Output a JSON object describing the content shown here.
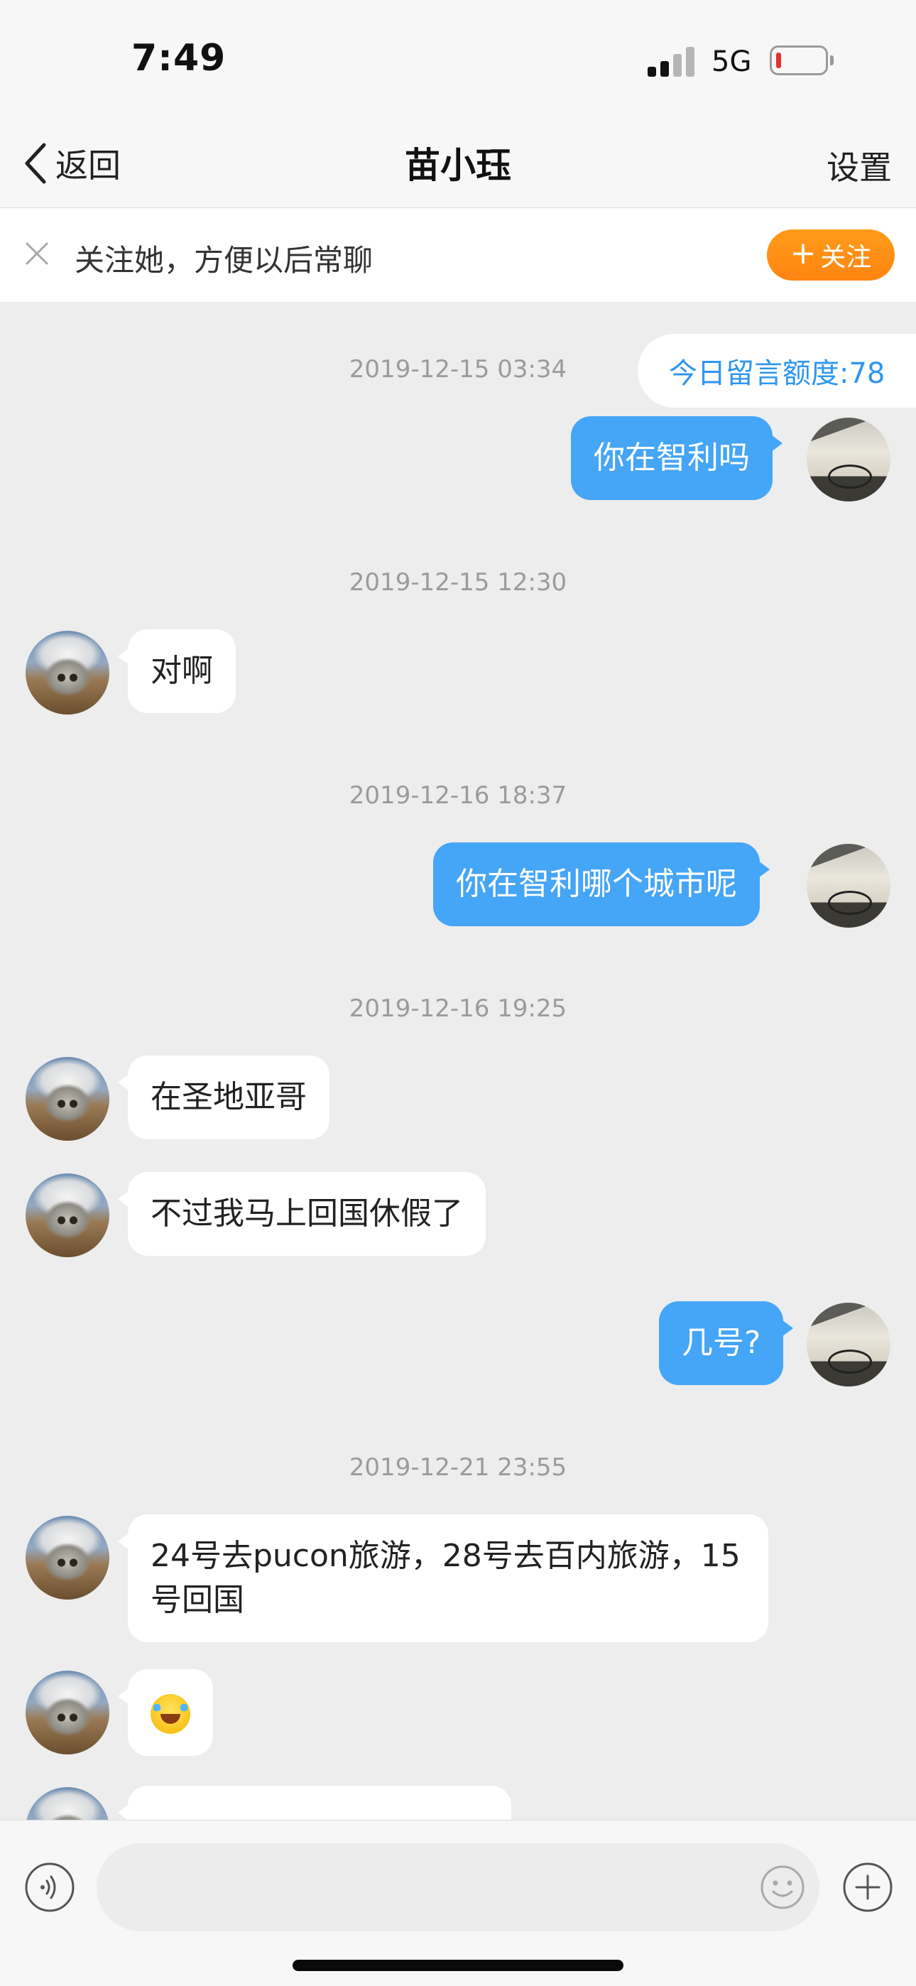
{
  "status_bar": {
    "time": "7:49",
    "network": "5G"
  },
  "nav": {
    "back_label": "返回",
    "title": "苗小珏",
    "settings_label": "设置"
  },
  "follow_banner": {
    "text": "关注她，方便以后常聊",
    "button_label": "关注",
    "button_color": "#ff8f12"
  },
  "quota_label": "今日留言额度:78",
  "colors": {
    "outgoing_bubble": "#45a5f6",
    "incoming_bubble": "#ffffff",
    "background": "#ededed"
  },
  "messages": [
    {
      "timestamp": "2019-12-15 03:34"
    },
    {
      "sender": "me",
      "text": "你在智利吗"
    },
    {
      "timestamp": "2019-12-15 12:30"
    },
    {
      "sender": "other",
      "text": "对啊"
    },
    {
      "timestamp": "2019-12-16 18:37"
    },
    {
      "sender": "me",
      "text": "你在智利哪个城市呢"
    },
    {
      "timestamp": "2019-12-16 19:25"
    },
    {
      "sender": "other",
      "text": "在圣地亚哥"
    },
    {
      "sender": "other",
      "text": "不过我马上回国休假了"
    },
    {
      "sender": "me",
      "text": "几号?"
    },
    {
      "timestamp": "2019-12-21 23:55"
    },
    {
      "sender": "other",
      "text": "24号去pucon旅游，28号去百内旅游，15号回国"
    },
    {
      "sender": "other",
      "emoji": "face-with-tears-of-joy"
    }
  ],
  "input_bar": {
    "placeholder": ""
  }
}
